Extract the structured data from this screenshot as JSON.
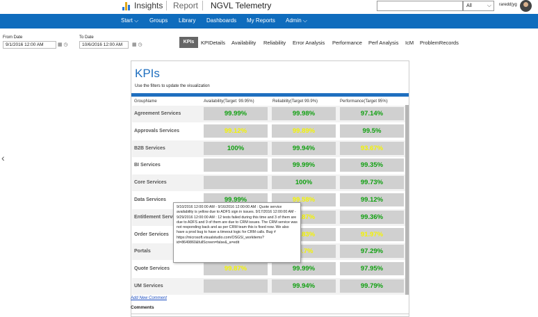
{
  "header": {
    "brand": "Insights",
    "report_label": "Report",
    "app_title": "NGVL Telemetry",
    "search_placeholder": "",
    "scope_value": "All",
    "user_name": "raredd(yg",
    "logo_colors": [
      "#2c7ad6",
      "#e0a81a",
      "#2c7ad6",
      "#d84a1b"
    ]
  },
  "nav": {
    "items": [
      "Start ⌵",
      "Groups",
      "Library",
      "Dashboards",
      "My Reports",
      "Admin ⌵"
    ]
  },
  "filters": {
    "from_label": "From Date",
    "from_value": "9/1/2016 12:00 AM",
    "to_label": "To Date",
    "to_value": "10/6/2016 12:00 AM"
  },
  "tabs": {
    "active": "KPIs",
    "items": [
      "KPIDetails",
      "Availability",
      "Reliability",
      "Error Analysis",
      "Performance",
      "Perf Analysis",
      "IcM",
      "ProblemRecords"
    ]
  },
  "report": {
    "title": "KPIs",
    "subtitle": "Use the filters to update the visualization",
    "columns": [
      "GroupName",
      "Availability(Target: 99.95%)",
      "Reliability(Target 99.9%)",
      "Performance(Target 95%)"
    ],
    "rows": [
      {
        "group": "Agreement Services",
        "availability": "99.99%",
        "avail_status": "green",
        "reliability": "99.98%",
        "rel_status": "green",
        "performance": "97.14%",
        "perf_status": "green"
      },
      {
        "group": "Approvals Services",
        "availability": "99.12%",
        "avail_status": "yellow",
        "reliability": "99.89%",
        "rel_status": "yellow",
        "performance": "99.5%",
        "perf_status": "green"
      },
      {
        "group": "B2B Services",
        "availability": "100%",
        "avail_status": "green",
        "reliability": "99.94%",
        "rel_status": "green",
        "performance": "93.67%",
        "perf_status": "yellow"
      },
      {
        "group": "BI Services",
        "availability": "",
        "avail_status": "green",
        "reliability": "99.99%",
        "rel_status": "green",
        "performance": "99.35%",
        "perf_status": "green"
      },
      {
        "group": "Core Services",
        "availability": "",
        "avail_status": "green",
        "reliability": "100%",
        "rel_status": "green",
        "performance": "99.73%",
        "perf_status": "green"
      },
      {
        "group": "Data Services",
        "availability": "99.99%",
        "avail_status": "green",
        "reliability": "99.58%",
        "rel_status": "yellow",
        "performance": "99.12%",
        "perf_status": "green"
      },
      {
        "group": "Entitlement Services",
        "availability": "",
        "avail_status": "green",
        "reliability": "99.87%",
        "rel_status": "yellow",
        "performance": "99.36%",
        "perf_status": "green"
      },
      {
        "group": "Order Services",
        "availability": "",
        "avail_status": "green",
        "reliability": "99.83%",
        "rel_status": "yellow",
        "performance": "91.97%",
        "perf_status": "yellow"
      },
      {
        "group": "Portals",
        "availability": "",
        "avail_status": "green",
        "reliability": "99.7%",
        "rel_status": "yellow",
        "performance": "97.29%",
        "perf_status": "green"
      },
      {
        "group": "Quote Services",
        "availability": "99.87%",
        "avail_status": "yellow",
        "reliability": "99.99%",
        "rel_status": "green",
        "performance": "97.95%",
        "perf_status": "green"
      },
      {
        "group": "UM Services",
        "availability": "",
        "avail_status": "green",
        "reliability": "99.94%",
        "rel_status": "green",
        "performance": "99.79%",
        "perf_status": "green"
      }
    ],
    "status_colors": {
      "green": "#10a010",
      "yellow": "#f4f400"
    }
  },
  "tooltip": {
    "text": "9/10/2016 12:00:00 AM - 9/16/2016 12:00:00 AM : Quote service availability is yellow due to ADFS sign in issues. 9/17/2016 12:00:00 AM - 9/29/2016 12:00:00 AM : 12 tests failed during this time and 3 of them are due to ADFS and 9 of them are due to CRM issues. The CRM service was not responding back and as per CRM team this is fixed now. We also have a prod bug to have a timeout logic for CRM calls. Bug # https://microsoft.visualstudio.com/OSGS/_workitems?id=8649860&fullScreen=false&_a=edit"
  },
  "footer": {
    "add_comment": "Add New Comment",
    "comments_label": "Comments"
  }
}
